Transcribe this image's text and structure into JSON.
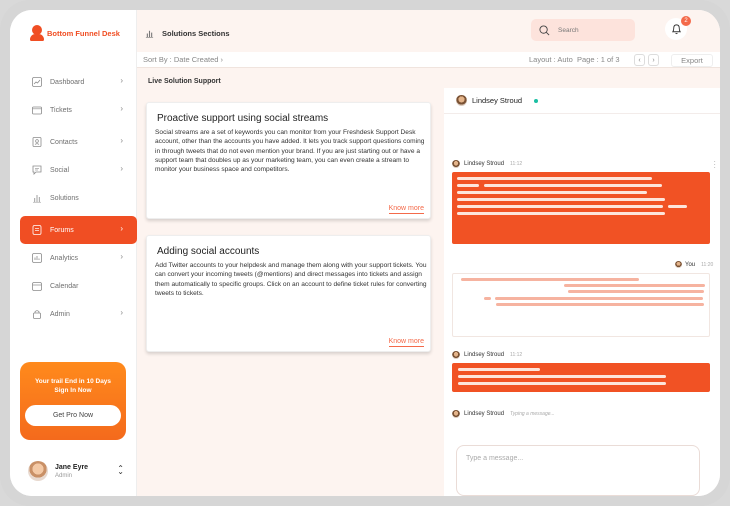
{
  "app": {
    "brand": "Bottom Funnel Desk"
  },
  "sidebar": {
    "items": [
      {
        "label": "Dashboard",
        "icon": "dashboard-icon",
        "has_chevron": true,
        "active": false
      },
      {
        "label": "Tickets",
        "icon": "ticket-icon",
        "has_chevron": true,
        "active": false
      },
      {
        "label": "Contacts",
        "icon": "contacts-icon",
        "has_chevron": true,
        "active": false
      },
      {
        "label": "Social",
        "icon": "social-icon",
        "has_chevron": true,
        "active": false
      },
      {
        "label": "Solutions",
        "icon": "solutions-icon",
        "has_chevron": false,
        "active": false
      },
      {
        "label": "Forums",
        "icon": "forums-icon",
        "has_chevron": true,
        "active": true
      },
      {
        "label": "Analytics",
        "icon": "analytics-icon",
        "has_chevron": true,
        "active": false
      },
      {
        "label": "Calendar",
        "icon": "calendar-icon",
        "has_chevron": false,
        "active": false
      },
      {
        "label": "Admin",
        "icon": "admin-icon",
        "has_chevron": true,
        "active": false
      }
    ],
    "promo": {
      "line1": "Your trail End in 10 Days",
      "line2": "Sign In Now",
      "button": "Get Pro Now"
    },
    "user": {
      "name": "Jane Eyre",
      "role": "Admin"
    }
  },
  "header": {
    "title": "Solutions Sections",
    "search_placeholder": "Search",
    "notification_count": "2"
  },
  "toolbar": {
    "sort": "Sort By : Date Created",
    "layout": "Layout : Auto",
    "page": "Page : 1 of 3",
    "export": "Export"
  },
  "main": {
    "section_title": "Live Solution Support",
    "cards": [
      {
        "title": "Proactive support using social streams",
        "body": "Social streams are a set of keywords you can monitor from your Freshdesk Support Desk account, other than the accounts you have added. It lets you track support questions coming in through tweets that do not even mention your brand. If you are just starting out or have a support team that doubles up as your marketing team, you can even create a stream to monitor your business space and competitors.",
        "link": "Know more"
      },
      {
        "title": "Adding social accounts",
        "body": "Add Twitter accounts to your helpdesk and manage them along with your support tickets. You can convert your incoming tweets (@mentions) and direct messages into tickets and assign them automatically to specific groups. Click on an account to define ticket rules for converting tweets to tickets.",
        "link": "Know more"
      }
    ]
  },
  "chat": {
    "contact_name": "Lindsey Stroud",
    "messages": [
      {
        "sender": "Lindsey Stroud",
        "time": "11:12"
      },
      {
        "sender": "You",
        "time": "11:20"
      },
      {
        "sender": "Lindsey Stroud",
        "time": "11:12"
      }
    ],
    "typing": {
      "sender": "Lindsey Stroud",
      "text": "Typing a message..."
    },
    "compose_placeholder": "Type a message...",
    "colors": {
      "accent": "#f15224",
      "online": "#1bbfa3"
    }
  }
}
